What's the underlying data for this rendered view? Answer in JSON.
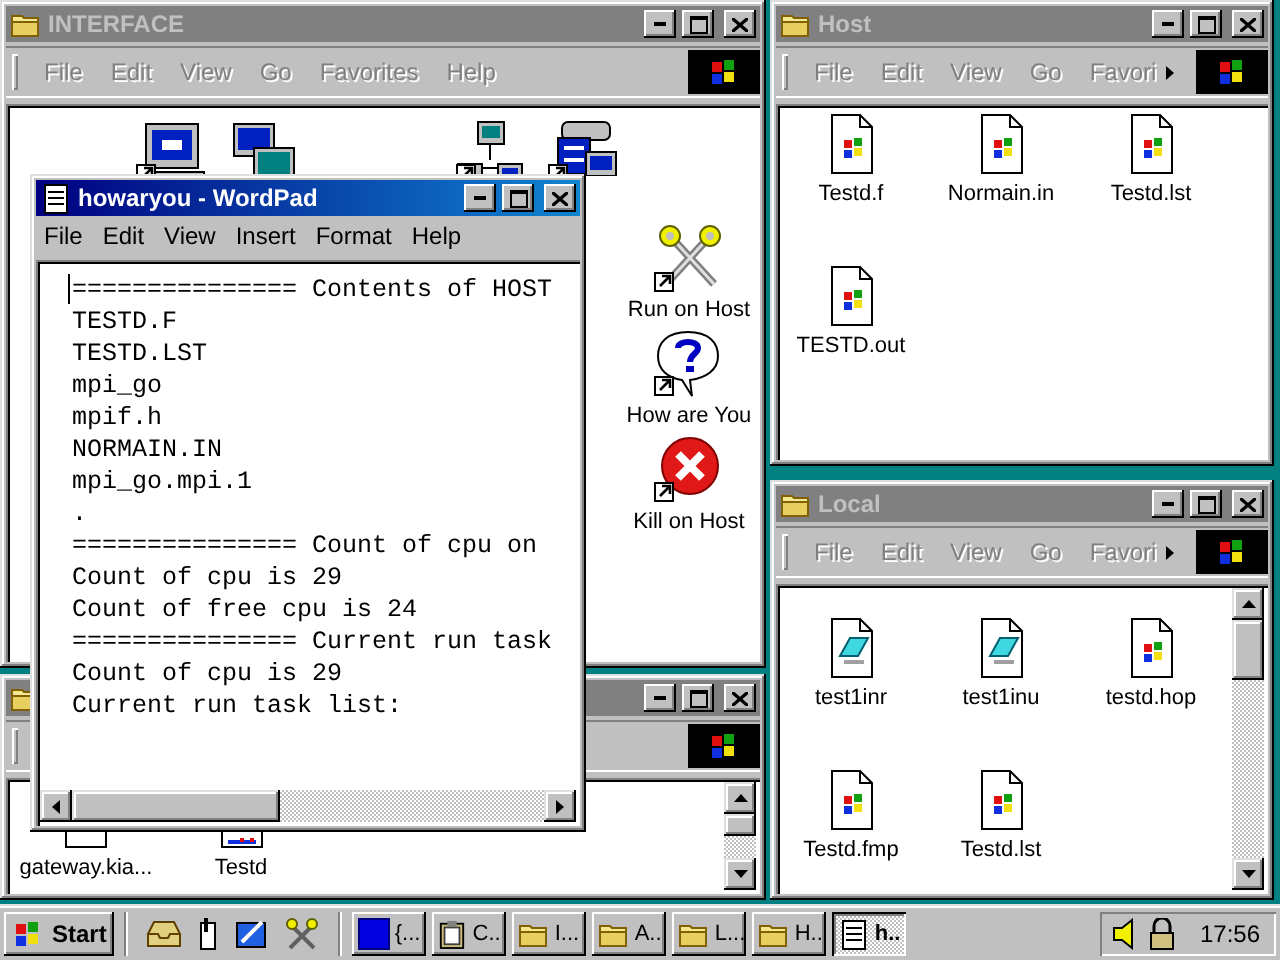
{
  "interface_window": {
    "title": "INTERFACE",
    "active": false,
    "menu": [
      "File",
      "Edit",
      "View",
      "Go",
      "Favorites",
      "Help"
    ],
    "top_icons": [
      {
        "kind": "computer"
      },
      {
        "kind": "computers"
      },
      {
        "kind": "network"
      },
      {
        "kind": "dos"
      }
    ],
    "shortcuts": [
      {
        "kind": "run",
        "label": "Run on Host"
      },
      {
        "kind": "question",
        "label": "How are You"
      },
      {
        "kind": "kill",
        "label": "Kill on Host"
      }
    ]
  },
  "lower_window": {
    "active": false,
    "files": [
      {
        "kind": "blank",
        "label": "gateway.kia..."
      },
      {
        "kind": "chart",
        "label": "Testd"
      }
    ]
  },
  "host_window": {
    "title": "Host",
    "active": false,
    "menu": [
      "File",
      "Edit",
      "View",
      "Go",
      "Favori"
    ],
    "chevron": true,
    "files": [
      {
        "kind": "flag",
        "label": "Testd.f"
      },
      {
        "kind": "flag",
        "label": "Normain.in"
      },
      {
        "kind": "flag",
        "label": "Testd.lst"
      },
      {
        "kind": "flag",
        "label": "TESTD.out"
      }
    ]
  },
  "local_window": {
    "title": "Local",
    "active": false,
    "menu": [
      "File",
      "Edit",
      "View",
      "Go",
      "Favori"
    ],
    "chevron": true,
    "files": [
      {
        "kind": "app",
        "label": "test1inr"
      },
      {
        "kind": "app",
        "label": "test1inu"
      },
      {
        "kind": "flag",
        "label": "testd.hop"
      },
      {
        "kind": "flag",
        "label": "Testd.fmp"
      },
      {
        "kind": "flag",
        "label": "Testd.lst"
      }
    ]
  },
  "wordpad": {
    "title": "howaryou - WordPad",
    "active": true,
    "menu": [
      "File",
      "Edit",
      "View",
      "Insert",
      "Format",
      "Help"
    ],
    "lines": [
      "=============== Contents of HOST",
      "TESTD.F",
      "TESTD.LST",
      "mpi_go",
      "mpif.h",
      "NORMAIN.IN",
      "mpi_go.mpi.1",
      ".",
      "=============== Count of cpu on",
      "Count of cpu is 29",
      "Count of free cpu is 24",
      "=============== Current run task",
      "Count of cpu is 29",
      "Current run task list:"
    ]
  },
  "taskbar": {
    "start": "Start",
    "tasks": [
      {
        "kind": "window",
        "label": "{...",
        "selected": false
      },
      {
        "kind": "clipboard",
        "label": "C..",
        "selected": false
      },
      {
        "kind": "folder",
        "label": "I...",
        "selected": false
      },
      {
        "kind": "folder",
        "label": "A..",
        "selected": false
      },
      {
        "kind": "folder",
        "label": "L...",
        "selected": false
      },
      {
        "kind": "folder",
        "label": "H..",
        "selected": false
      },
      {
        "kind": "wordpad",
        "label": "h..",
        "selected": true
      }
    ],
    "clock": "17:56"
  }
}
